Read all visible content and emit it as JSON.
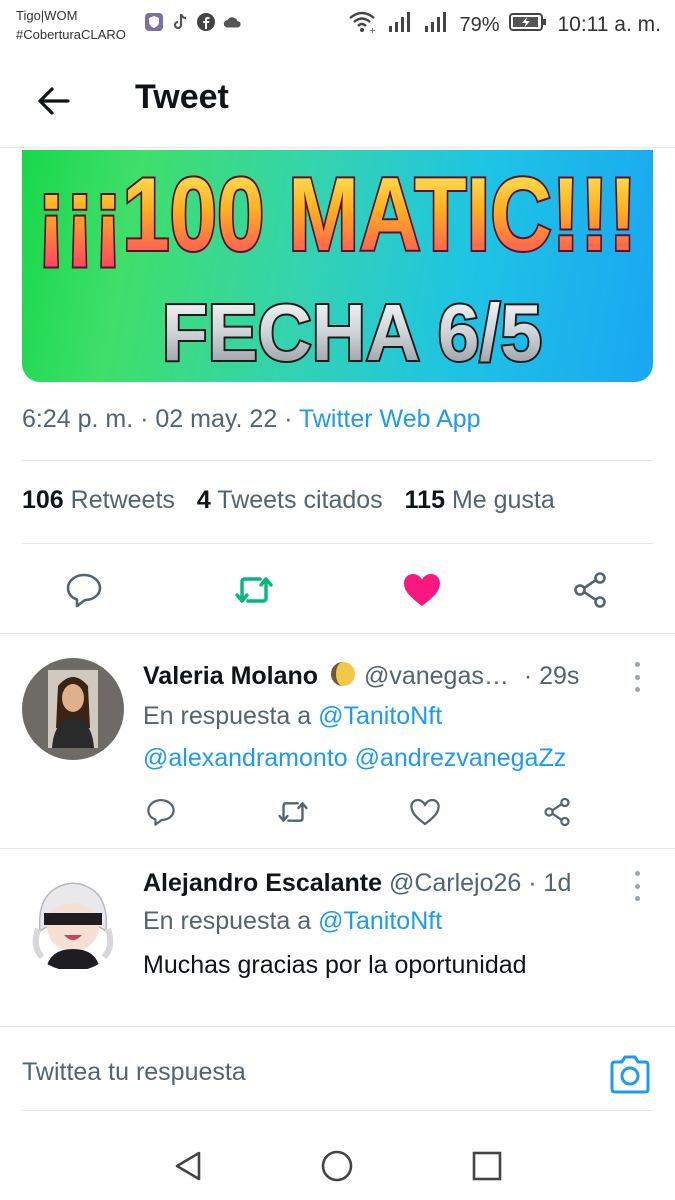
{
  "status_bar": {
    "carrier_line1": "Tigo|WOM",
    "carrier_line2": "#CoberturaCLARO",
    "battery_pct": "79%",
    "time": "10:11 a. m.",
    "app_icons": [
      "shield-app-icon",
      "tiktok-icon",
      "facebook-icon",
      "cloud-icon"
    ]
  },
  "header": {
    "title": "Tweet"
  },
  "banner": {
    "line1": "¡¡¡100 MATIC!!!",
    "line2": "FECHA 6/5"
  },
  "meta": {
    "time": "6:24 p. m.",
    "sep1": " · ",
    "date": "02 may. 22",
    "sep2": " · ",
    "source": "Twitter Web App"
  },
  "stats": {
    "retweets_count": "106",
    "retweets_label": "Retweets",
    "quotes_count": "4",
    "quotes_label": "Tweets citados",
    "likes_count": "115",
    "likes_label": "Me gusta"
  },
  "colors": {
    "accent": "#1d9bf0",
    "retweet_green": "#00ba7c",
    "like_pink": "#f91880",
    "muted": "#536471"
  },
  "replies": [
    {
      "name": "Valeria Molano",
      "handle": "@vanegas…",
      "time": "· 29s",
      "reply_to_label": "En respuesta a ",
      "reply_to_user": "@TanitoNft",
      "mentions": "@alexandramonto @andrezvanegaZz"
    },
    {
      "name": "Alejandro Escalante",
      "handle": "@Carlejo26",
      "time": "· 1d",
      "reply_to_label": "En respuesta a ",
      "reply_to_user": "@TanitoNft",
      "text": "Muchas gracias por la oportunidad"
    }
  ],
  "compose": {
    "placeholder": "Twittea tu respuesta"
  }
}
